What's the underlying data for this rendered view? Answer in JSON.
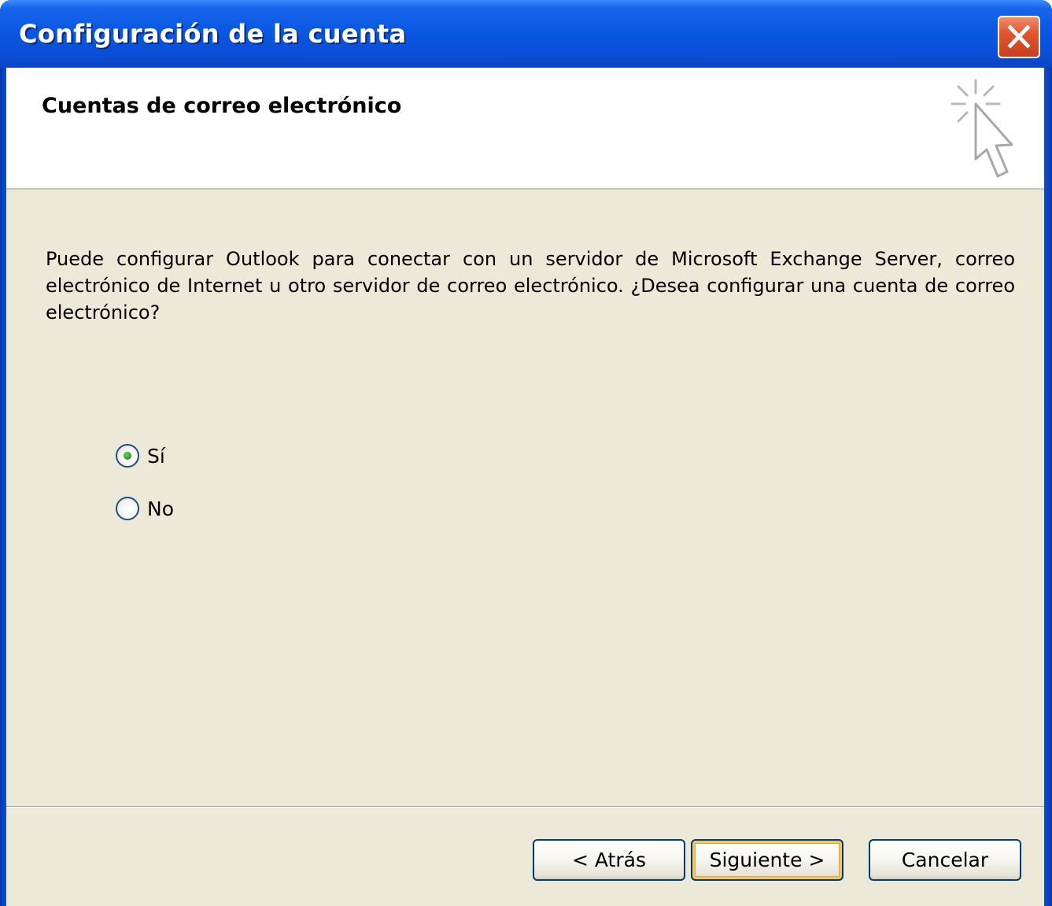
{
  "window": {
    "title": "Configuración de la cuenta"
  },
  "header": {
    "title": "Cuentas de correo electrónico"
  },
  "body": {
    "description": "Puede configurar Outlook para conectar con un servidor de Microsoft Exchange Server, correo electrónico de Internet u otro servidor de correo electrónico. ¿Desea configurar una cuenta de correo electrónico?"
  },
  "options": {
    "yes_label": "Sí",
    "no_label": "No",
    "selected": "Sí"
  },
  "buttons": {
    "back": "< Atrás",
    "next": "Siguiente >",
    "cancel": "Cancelar"
  },
  "icons": {
    "close": "close-icon",
    "wizard": "cursor-sparkle-icon"
  },
  "colors": {
    "titlebar": "#0a58e2",
    "close_button": "#e2552f",
    "dialog_background": "#ece9d8",
    "radio_selected_dot": "#2e9b2e",
    "default_button_highlight": "#f7c35a"
  }
}
